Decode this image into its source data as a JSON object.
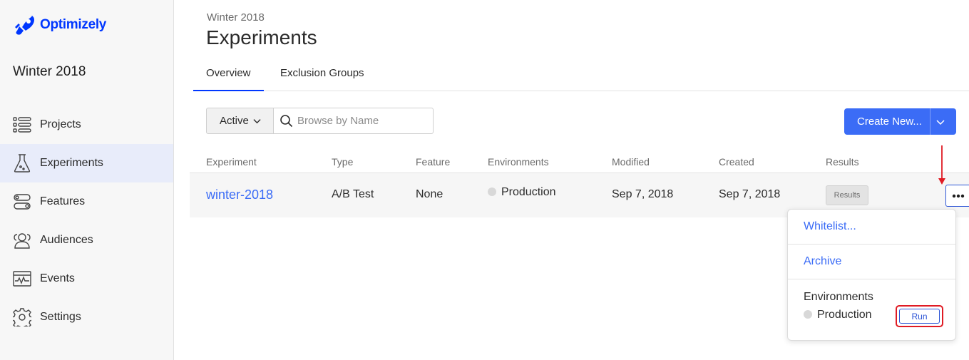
{
  "brand": {
    "name": "Optimizely",
    "color": "#0037ff"
  },
  "sidebar": {
    "project_name": "Winter 2018",
    "items": [
      {
        "label": "Projects",
        "icon": "list-icon"
      },
      {
        "label": "Experiments",
        "icon": "flask-icon",
        "active": true
      },
      {
        "label": "Features",
        "icon": "toggle-icon"
      },
      {
        "label": "Audiences",
        "icon": "users-icon"
      },
      {
        "label": "Events",
        "icon": "pulse-icon"
      },
      {
        "label": "Settings",
        "icon": "gear-icon"
      }
    ]
  },
  "header": {
    "breadcrumb": "Winter 2018",
    "title": "Experiments",
    "tabs": [
      {
        "label": "Overview",
        "active": true
      },
      {
        "label": "Exclusion Groups"
      }
    ]
  },
  "toolbar": {
    "filter_value": "Active",
    "search_placeholder": "Browse by Name",
    "create_label": "Create New..."
  },
  "table": {
    "columns": [
      "Experiment",
      "Type",
      "Feature",
      "Environments",
      "Modified",
      "Created",
      "Results"
    ],
    "rows": [
      {
        "experiment": "winter-2018",
        "type": "A/B Test",
        "feature": "None",
        "environment": "Production",
        "modified": "Sep 7, 2018",
        "created": "Sep 7, 2018",
        "results": "Results"
      }
    ]
  },
  "actions_menu": {
    "items": [
      "Whitelist...",
      "Archive"
    ],
    "environments_title": "Environments",
    "environment": "Production",
    "run_label": "Run"
  },
  "colors": {
    "accent": "#3b6cf6",
    "highlight": "#e01b24",
    "active_nav_bg": "#e8ecfa"
  }
}
